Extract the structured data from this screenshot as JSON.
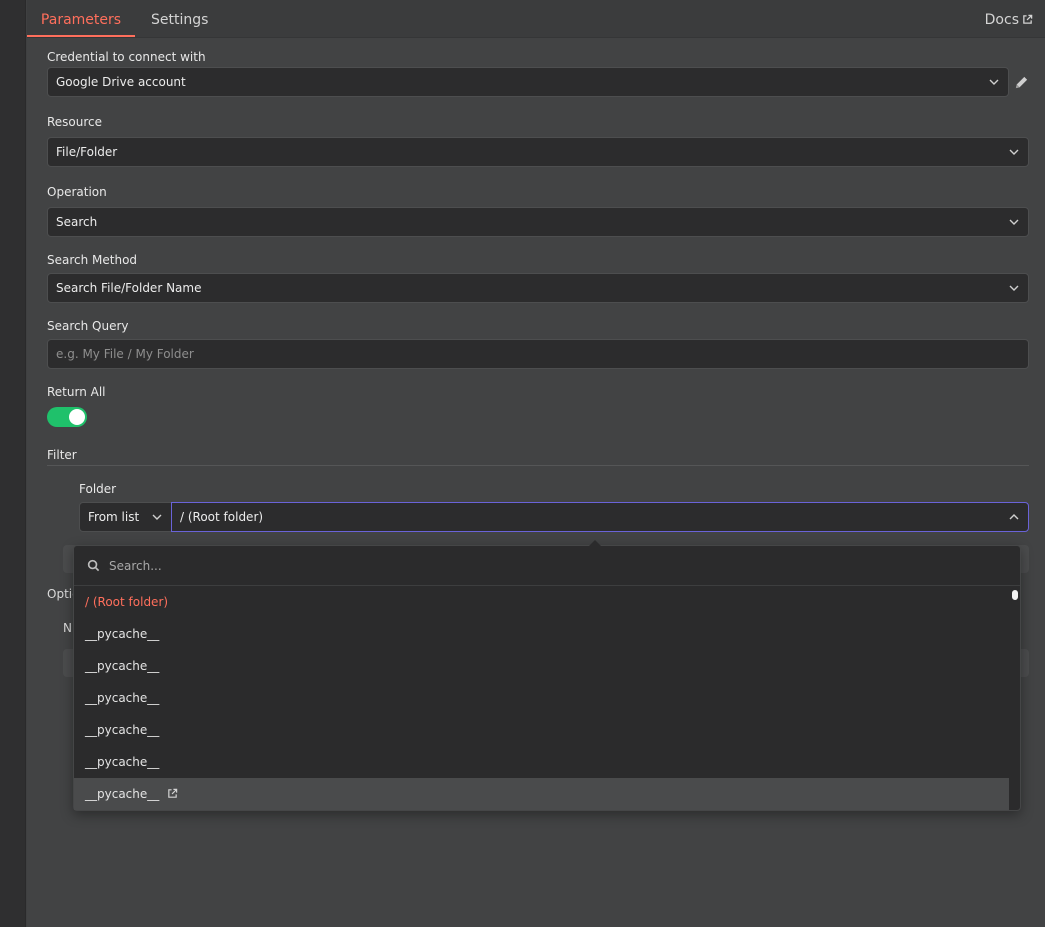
{
  "tabs": {
    "parameters": "Parameters",
    "settings": "Settings",
    "docs": "Docs"
  },
  "credential": {
    "label": "Credential to connect with",
    "value": "Google Drive account"
  },
  "resource": {
    "label": "Resource",
    "value": "File/Folder"
  },
  "operation": {
    "label": "Operation",
    "value": "Search"
  },
  "search_method": {
    "label": "Search Method",
    "value": "Search File/Folder Name"
  },
  "search_query": {
    "label": "Search Query",
    "placeholder": "e.g. My File / My Folder"
  },
  "return_all": {
    "label": "Return All",
    "enabled": true
  },
  "filter": {
    "label": "Filter",
    "folder_label": "Folder",
    "mode": "From list",
    "value": "/ (Root folder)"
  },
  "partially_hidden": {
    "options_fragment": "Optic",
    "n_fragment": "N"
  },
  "dropdown": {
    "search_placeholder": "Search...",
    "items": [
      {
        "label": "/ (Root folder)",
        "selected": true
      },
      {
        "label": "__pycache__"
      },
      {
        "label": "__pycache__"
      },
      {
        "label": "__pycache__"
      },
      {
        "label": "__pycache__"
      },
      {
        "label": "__pycache__"
      },
      {
        "label": "__pycache__",
        "hovered": true
      }
    ]
  },
  "colors": {
    "accent": "#ff6f5c",
    "toggle_on": "#1fc16b",
    "focus_border": "#6a63d8"
  }
}
